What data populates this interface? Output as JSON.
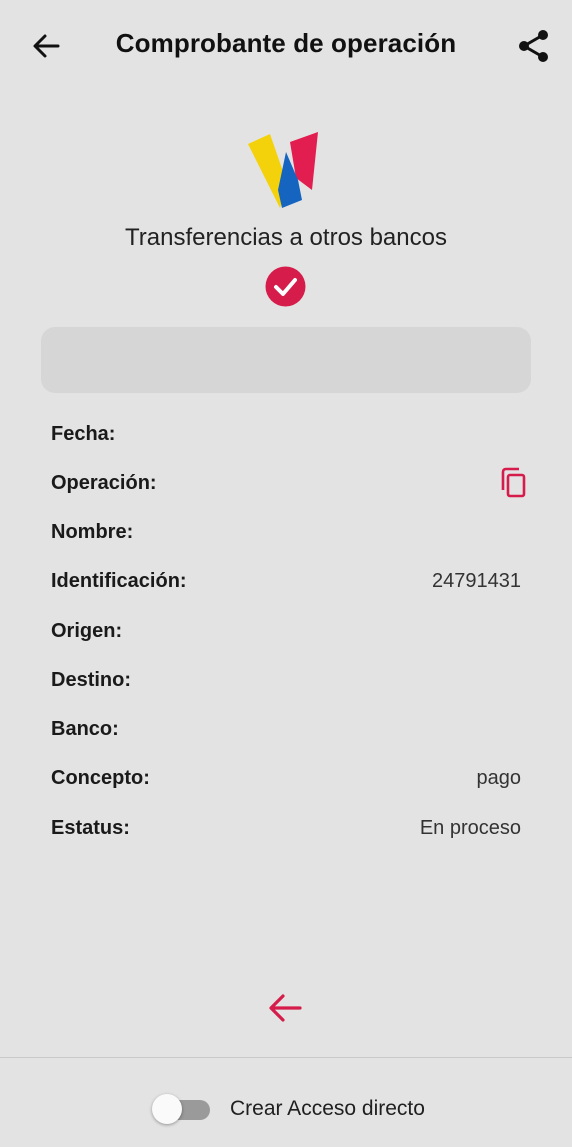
{
  "header": {
    "title": "Comprobante de operación",
    "back_icon": "arrow-left-icon",
    "share_icon": "share-icon"
  },
  "logo": "bank-logo",
  "subtitle": "Transferencias a otros bancos",
  "status_icon": "check-circle-icon",
  "colors": {
    "accent": "#d51c4a",
    "background": "#e3e3e3"
  },
  "details": {
    "fecha": {
      "label": "Fecha:",
      "value": ""
    },
    "operacion": {
      "label": "Operación:",
      "value": ""
    },
    "nombre": {
      "label": "Nombre:",
      "value": ""
    },
    "identificacion": {
      "label": "Identificación:",
      "value": "24791431"
    },
    "origen": {
      "label": "Origen:",
      "value": ""
    },
    "destino": {
      "label": "Destino:",
      "value": ""
    },
    "banco": {
      "label": "Banco:",
      "value": ""
    },
    "concepto": {
      "label": "Concepto:",
      "value": "pago"
    },
    "estatus": {
      "label": "Estatus:",
      "value": "En proceso"
    }
  },
  "footer": {
    "toggle_label": "Crear Acceso directo",
    "toggle_on": false
  }
}
